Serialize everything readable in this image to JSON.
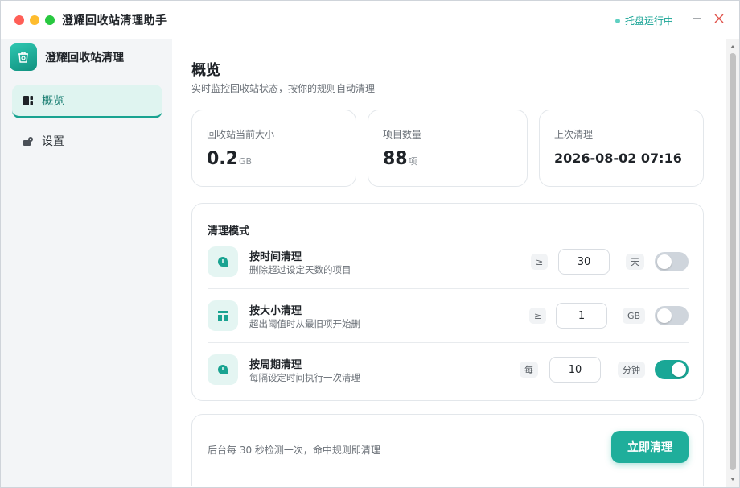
{
  "app": {
    "title": "澄耀回收站清理助手",
    "tray_status": "托盘运行中"
  },
  "sidebar": {
    "brand": "澄耀回收站清理",
    "items": [
      {
        "label": "概览",
        "icon": "dashboard-icon",
        "active": true
      },
      {
        "label": "设置",
        "icon": "settings-icon",
        "active": false
      }
    ]
  },
  "overview": {
    "title": "概览",
    "subtitle": "实时监控回收站状态，按你的规则自动清理",
    "stats": {
      "size": {
        "label": "回收站当前大小",
        "value": "0.2",
        "unit": "GB"
      },
      "count": {
        "label": "项目数量",
        "value": "88",
        "unit": "项"
      },
      "last_clean": {
        "label": "上次清理",
        "value": "2026-08-02 07:16"
      }
    }
  },
  "modes": {
    "title": "清理模式",
    "by_time": {
      "name": "按时间清理",
      "desc": "删除超过设定天数的项目",
      "prefix": "≥",
      "value": "30",
      "unit": "天",
      "enabled": false
    },
    "by_size": {
      "name": "按大小清理",
      "desc": "超出阈值时从最旧项开始删",
      "prefix": "≥",
      "value": "1",
      "unit": "GB",
      "enabled": false
    },
    "by_period": {
      "name": "按周期清理",
      "desc": "每隔设定时间执行一次清理",
      "prefix": "每",
      "value": "10",
      "unit": "分钟",
      "enabled": true
    }
  },
  "footer": {
    "note": "后台每 30 秒检测一次，命中规则即清理",
    "clean_button": "立即清理"
  },
  "colors": {
    "accent": "#1fae9b",
    "accent_soft": "#dff4f0"
  }
}
